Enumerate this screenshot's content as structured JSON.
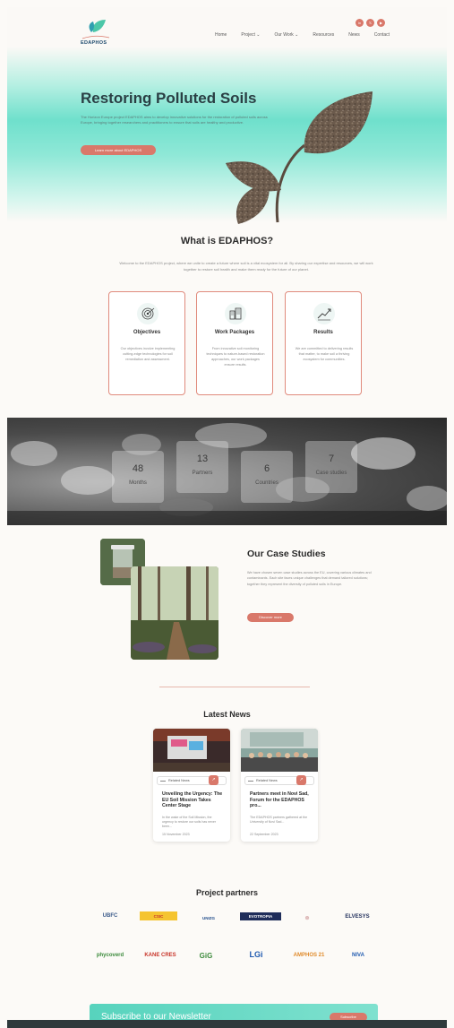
{
  "header": {
    "logo_text": "EDAPHOS",
    "nav": [
      {
        "label": "Home"
      },
      {
        "label": "Project ⌄"
      },
      {
        "label": "Our Work ⌄"
      },
      {
        "label": "Resources"
      },
      {
        "label": "News"
      },
      {
        "label": "Contact"
      }
    ],
    "socials": [
      "in",
      "𝕏",
      "▶"
    ]
  },
  "hero": {
    "title": "Restoring Polluted Soils",
    "text": "The Horizon Europe project EDAPHOS aims to develop innovative solutions for the restoration of polluted soils across Europe, bringing together researchers and practitioners to ensure that soils are healthy and productive.",
    "button": "Learn more about EDAPHOS"
  },
  "what": {
    "title": "What is EDAPHOS?",
    "text": "Welcome to the EDAPHOS project, where we unite to create a future where soil is a vital ecosystem for all. By sharing our expertise and resources, we will work together to restore soil health and make them ready for the future of our planet."
  },
  "cards": [
    {
      "title": "Objectives",
      "text": "Our objectives involve implementing cutting-edge technologies for soil remediation and assessment."
    },
    {
      "title": "Work Packages",
      "text": "From innovative soil monitoring techniques to nature-based restoration approaches, our work packages ensure results."
    },
    {
      "title": "Results",
      "text": "We are committed to delivering results that matter, to make soil a thriving ecosystem for communities."
    }
  ],
  "stats": [
    {
      "num": "48",
      "label": "Months"
    },
    {
      "num": "13",
      "label": "Partners"
    },
    {
      "num": "6",
      "label": "Countries"
    },
    {
      "num": "7",
      "label": "Case studies"
    }
  ],
  "case_studies": {
    "title": "Our Case Studies",
    "text": "We have chosen seven case studies across the EU, covering various climates and contaminants. Each site faces unique challenges that demand tailored solutions; together they represent the diversity of polluted soils in Europe.",
    "button": "Discover more"
  },
  "news": {
    "title": "Latest News",
    "items": [
      {
        "tag": "Related News",
        "arrow": "↗",
        "headline": "Unveiling the Urgency: The EU Soil Mission Takes Center Stage",
        "excerpt": "In the wake of the Soil Mission, the urgency to restore our soils has never been...",
        "date": "15 November 2023"
      },
      {
        "tag": "Related News",
        "arrow": "↗",
        "headline": "Partners meet in Novi Sad, Forum for the EDAPHOS pro...",
        "excerpt": "The EDAPHOS partners gathered at the University of Novi Sad...",
        "date": "22 September 2023"
      }
    ]
  },
  "partners": {
    "title": "Project partners",
    "logos": [
      {
        "name": "UBFC",
        "color": "#3b5a8a"
      },
      {
        "name": "CSIC",
        "color": "#c8352a"
      },
      {
        "name": "UNIZG",
        "color": "#1f4b8a"
      },
      {
        "name": "EVOTROPIA",
        "color": "#ffffff",
        "bg": "#1f2d5a"
      },
      {
        "name": "⊛",
        "color": "#d9b0b0"
      },
      {
        "name": "ELVESYS",
        "color": "#1f2d5a"
      },
      {
        "name": "phycoverd",
        "color": "#3b8a3b"
      },
      {
        "name": "KANE CRES",
        "color": "#c8352a"
      },
      {
        "name": "GiG",
        "color": "#3b8a3b"
      },
      {
        "name": "LGi",
        "color": "#1f5ab0"
      },
      {
        "name": "AMPHOS 21",
        "color": "#e08a2a"
      },
      {
        "name": "NIVA",
        "color": "#1f5ab0"
      }
    ]
  },
  "newsletter": {
    "title": "Subscribe to our Newsletter",
    "button": "Subscribe"
  },
  "colors": {
    "accent": "#d9786a",
    "teal": "#6fe0cc",
    "text_dark": "#2b2b2b"
  }
}
